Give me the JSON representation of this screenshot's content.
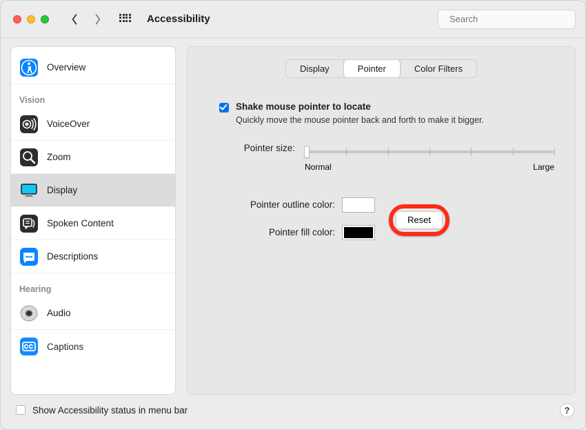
{
  "window": {
    "title": "Accessibility"
  },
  "search": {
    "placeholder": "Search"
  },
  "sidebar": {
    "sections": {
      "vision": "Vision",
      "hearing": "Hearing"
    },
    "items": {
      "overview": "Overview",
      "voiceover": "VoiceOver",
      "zoom": "Zoom",
      "display": "Display",
      "spoken": "Spoken Content",
      "descriptions": "Descriptions",
      "audio": "Audio",
      "captions": "Captions"
    }
  },
  "tabs": {
    "display": "Display",
    "pointer": "Pointer",
    "colorfilters": "Color Filters"
  },
  "pointer": {
    "shake_label": "Shake mouse pointer to locate",
    "shake_desc": "Quickly move the mouse pointer back and forth to make it bigger.",
    "size_label": "Pointer size:",
    "size_min": "Normal",
    "size_max": "Large",
    "outline_label": "Pointer outline color:",
    "fill_label": "Pointer fill color:",
    "reset_label": "Reset",
    "outline_color": "#ffffff",
    "fill_color": "#000000"
  },
  "footer": {
    "menubar_label": "Show Accessibility status in menu bar",
    "help": "?"
  }
}
